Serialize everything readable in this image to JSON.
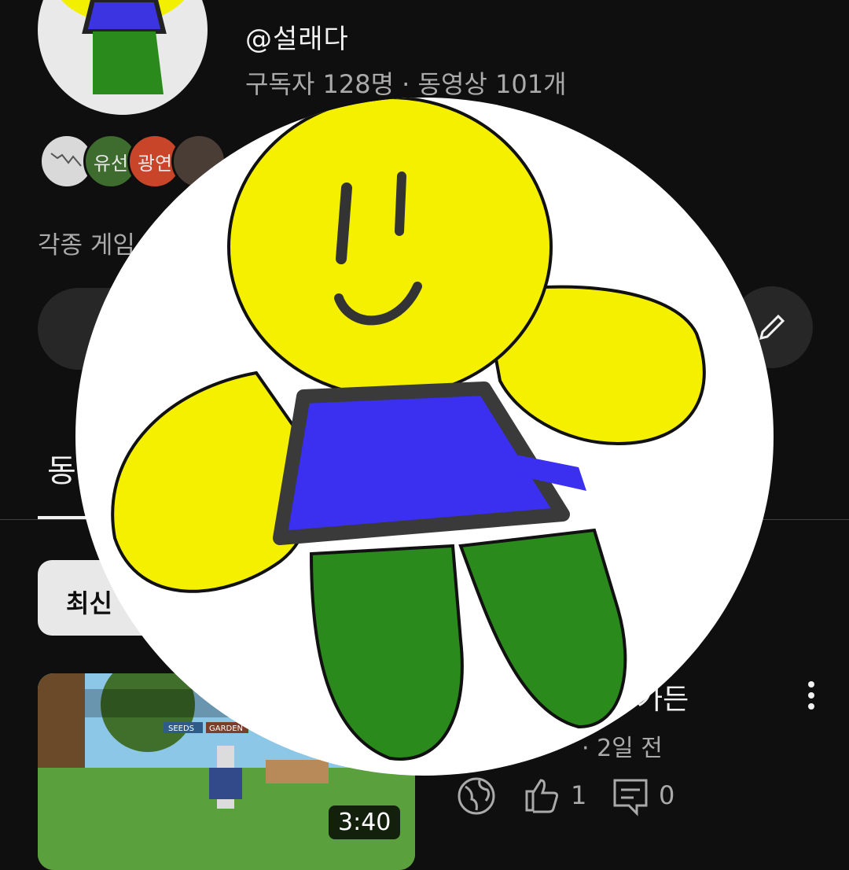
{
  "channel": {
    "handle": "@설래다",
    "stats": "구독자 128명 · 동영상 101개",
    "description": "각종 게임",
    "collaborators": [
      "유선",
      "광연"
    ]
  },
  "tabs": {
    "videos_label": "동"
  },
  "filter": {
    "chip_label": "최신"
  },
  "video": {
    "title_fragment": "가든",
    "meta_fragment": "· 2일 전",
    "duration": "3:40",
    "like_count": "1",
    "comment_count": "0",
    "thumb_tags": [
      "SEEDS",
      "GARDEN"
    ]
  },
  "icons": [
    "globe-icon",
    "thumbs-up-icon",
    "comment-icon",
    "more-vert-icon",
    "pencil-icon"
  ],
  "colors": {
    "background": "#0f0f0f",
    "text_secondary": "#aaaaaa",
    "chip_bg": "#e8e8e8"
  }
}
